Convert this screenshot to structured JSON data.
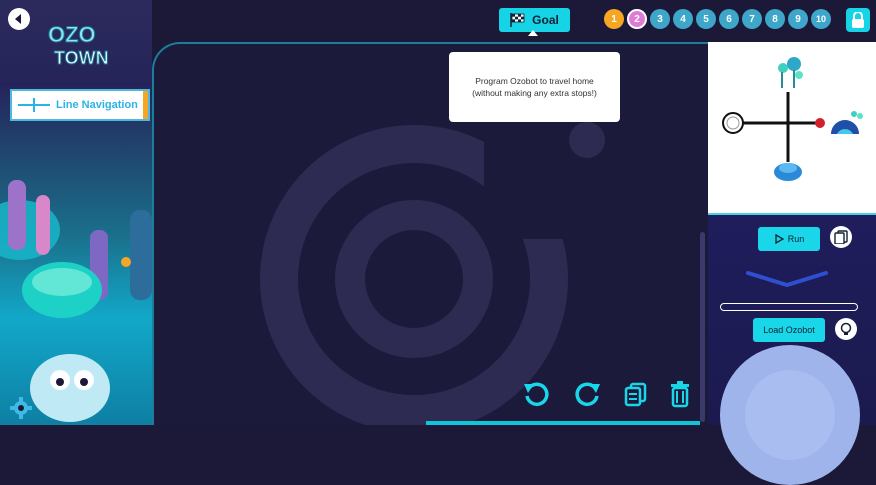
{
  "sidebar": {
    "logo_text_top": "OZO",
    "logo_text_bottom": "TOWN",
    "mode_label": "Line Navigation"
  },
  "topbar": {
    "goal_label": "Goal",
    "tooltip_line1": "Program Ozobot to travel home",
    "tooltip_line2": "(without making any extra stops!)",
    "levels": [
      {
        "label": "1",
        "color": "#f5a623",
        "state": "complete"
      },
      {
        "label": "2",
        "color": "#e07ad9",
        "state": "current"
      },
      {
        "label": "3",
        "color": "#3ea6c8",
        "state": "open"
      },
      {
        "label": "4",
        "color": "#3ea6c8",
        "state": "open"
      },
      {
        "label": "5",
        "color": "#3ea6c8",
        "state": "open"
      },
      {
        "label": "6",
        "color": "#3ea6c8",
        "state": "open"
      },
      {
        "label": "7",
        "color": "#3ea6c8",
        "state": "open"
      },
      {
        "label": "8",
        "color": "#3ea6c8",
        "state": "open"
      },
      {
        "label": "9",
        "color": "#3ea6c8",
        "state": "open"
      },
      {
        "label": "10",
        "color": "#3ea6c8",
        "state": "open"
      }
    ]
  },
  "controls": {
    "run_label": "Run",
    "load_label": "Load Ozobot"
  },
  "colors": {
    "accent": "#16d4e6",
    "canvas_bg": "#1c1a3a",
    "panel_bg": "#1f1d5c"
  }
}
